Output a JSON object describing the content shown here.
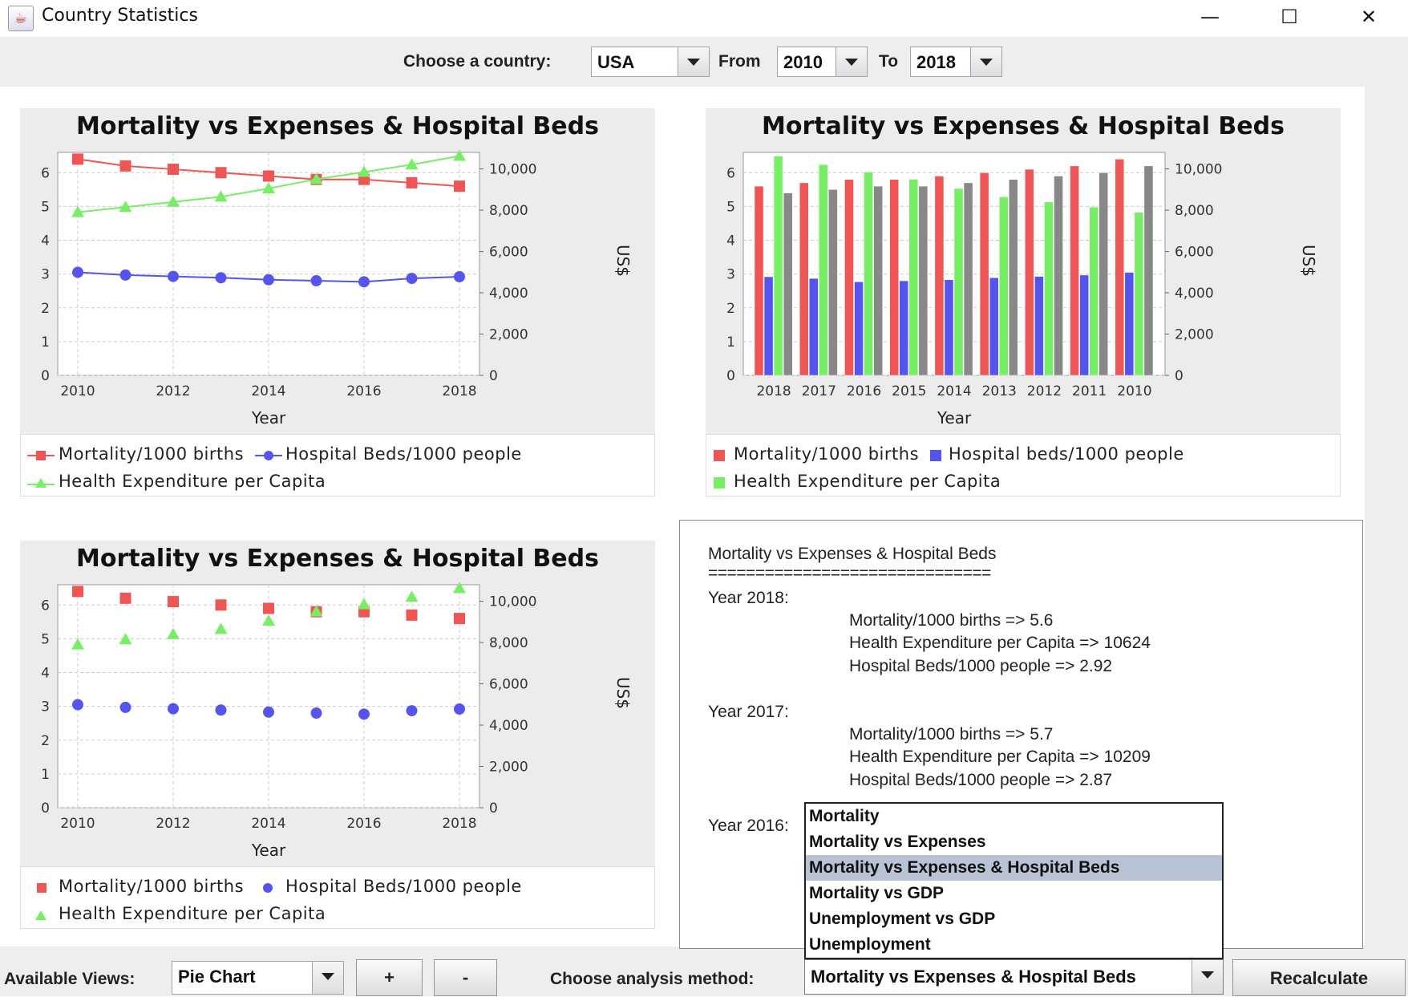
{
  "window": {
    "title": "Country Statistics",
    "controls": {
      "minimize": "—",
      "maximize": "☐",
      "close": "✕"
    }
  },
  "toolbar": {
    "country_label": "Choose a country:",
    "country_value": "USA",
    "from_label": "From",
    "from_value": "2010",
    "to_label": "To",
    "to_value": "2018"
  },
  "colors": {
    "mortality": "#ee5555",
    "beds": "#5555ee",
    "expenditure": "#77ee66",
    "series4": "#888888",
    "selection": "#b8c4d6"
  },
  "legend": {
    "mortality": "Mortality/1000 births",
    "beds_line": "Hospital Beds/1000 people",
    "beds_bar": "Hospital beds/1000 people",
    "expenditure": "Health Expenditure per Capita"
  },
  "chart_data": [
    {
      "type": "line",
      "title": "Mortality vs Expenses & Hospital Beds",
      "xlabel": "Year",
      "ylabel_right": "US$",
      "x_ticks": [
        "2010",
        "2012",
        "2014",
        "2016",
        "2018"
      ],
      "y_left_ticks": [
        "0",
        "1",
        "2",
        "3",
        "4",
        "5",
        "6"
      ],
      "y_right_ticks": [
        "0",
        "2,000",
        "4,000",
        "6,000",
        "8,000",
        "10,000"
      ],
      "ylim_left": [
        0,
        6.6
      ],
      "ylim_right": [
        0,
        10800
      ],
      "x": [
        2010,
        2011,
        2012,
        2013,
        2014,
        2015,
        2016,
        2017,
        2018
      ],
      "series": [
        {
          "name": "Mortality/1000 births",
          "axis": "left",
          "values": [
            6.4,
            6.2,
            6.1,
            6.0,
            5.9,
            5.8,
            5.8,
            5.7,
            5.6
          ]
        },
        {
          "name": "Hospital Beds/1000 people",
          "axis": "left",
          "values": [
            3.05,
            2.97,
            2.93,
            2.89,
            2.83,
            2.8,
            2.77,
            2.87,
            2.92
          ]
        },
        {
          "name": "Health Expenditure per Capita",
          "axis": "right",
          "values": [
            7900,
            8150,
            8400,
            8650,
            9050,
            9500,
            9850,
            10209,
            10624
          ]
        }
      ],
      "grid": true,
      "legend": "bottom"
    },
    {
      "type": "bar",
      "title": "Mortality vs Expenses & Hospital Beds",
      "xlabel": "Year",
      "ylabel_right": "US$",
      "categories": [
        "2018",
        "2017",
        "2016",
        "2015",
        "2014",
        "2013",
        "2012",
        "2011",
        "2010"
      ],
      "y_left_ticks": [
        "0",
        "1",
        "2",
        "3",
        "4",
        "5",
        "6"
      ],
      "y_right_ticks": [
        "0",
        "2,000",
        "4,000",
        "6,000",
        "8,000",
        "10,000"
      ],
      "ylim_left": [
        0,
        6.6
      ],
      "ylim_right": [
        0,
        10800
      ],
      "series": [
        {
          "name": "Mortality/1000 births",
          "axis": "left",
          "values": [
            5.6,
            5.7,
            5.8,
            5.8,
            5.9,
            6.0,
            6.1,
            6.2,
            6.4
          ]
        },
        {
          "name": "Hospital beds/1000 people",
          "axis": "left",
          "values": [
            2.92,
            2.87,
            2.77,
            2.8,
            2.83,
            2.89,
            2.93,
            2.97,
            3.05
          ]
        },
        {
          "name": "Health Expenditure per Capita",
          "axis": "right",
          "values": [
            10624,
            10209,
            9850,
            9500,
            9050,
            8650,
            8400,
            8150,
            7900
          ]
        },
        {
          "axis": "left",
          "values": [
            5.4,
            5.5,
            5.6,
            5.6,
            5.7,
            5.8,
            5.9,
            6.0,
            6.2
          ]
        }
      ],
      "grid": true,
      "legend": "bottom"
    },
    {
      "type": "scatter",
      "title": "Mortality vs Expenses & Hospital Beds",
      "xlabel": "Year",
      "ylabel_right": "US$",
      "x_ticks": [
        "2010",
        "2012",
        "2014",
        "2016",
        "2018"
      ],
      "y_left_ticks": [
        "0",
        "1",
        "2",
        "3",
        "4",
        "5",
        "6"
      ],
      "y_right_ticks": [
        "0",
        "2,000",
        "4,000",
        "6,000",
        "8,000",
        "10,000"
      ],
      "ylim_left": [
        0,
        6.6
      ],
      "ylim_right": [
        0,
        10800
      ],
      "x": [
        2010,
        2011,
        2012,
        2013,
        2014,
        2015,
        2016,
        2017,
        2018
      ],
      "series": [
        {
          "name": "Mortality/1000 births",
          "axis": "left",
          "values": [
            6.4,
            6.2,
            6.1,
            6.0,
            5.9,
            5.8,
            5.8,
            5.7,
            5.6
          ]
        },
        {
          "name": "Hospital Beds/1000 people",
          "axis": "left",
          "values": [
            3.05,
            2.97,
            2.93,
            2.89,
            2.83,
            2.8,
            2.77,
            2.87,
            2.92
          ]
        },
        {
          "name": "Health Expenditure per Capita",
          "axis": "right",
          "values": [
            7900,
            8150,
            8400,
            8650,
            9050,
            9500,
            9850,
            10209,
            10624
          ]
        }
      ],
      "grid": true,
      "legend": "bottom"
    }
  ],
  "report": {
    "title": "Mortality vs Expenses & Hospital Beds",
    "separator": "==============================",
    "years": [
      {
        "label": "Year 2018:",
        "lines": [
          "Mortality/1000 births => 5.6",
          "Health Expenditure per Capita => 10624",
          "Hospital Beds/1000 people => 2.92"
        ]
      },
      {
        "label": "Year 2017:",
        "lines": [
          "Mortality/1000 births => 5.7",
          "Health Expenditure per Capita => 10209",
          "Hospital Beds/1000 people => 2.87"
        ]
      },
      {
        "label": "Year 2016:",
        "lines": []
      }
    ]
  },
  "analysis_dropdown": {
    "options": [
      "Mortality",
      "Mortality vs Expenses",
      "Mortality vs Expenses & Hospital Beds",
      "Mortality vs GDP",
      "Unemployment vs GDP",
      "Unemployment"
    ],
    "selected_index": 2
  },
  "bottom": {
    "views_label": "Available Views:",
    "views_value": "Pie Chart",
    "add_label": "+",
    "remove_label": "-",
    "method_label": "Choose analysis method:",
    "method_value": "Mortality vs Expenses & Hospital Beds",
    "recalc_label": "Recalculate"
  }
}
